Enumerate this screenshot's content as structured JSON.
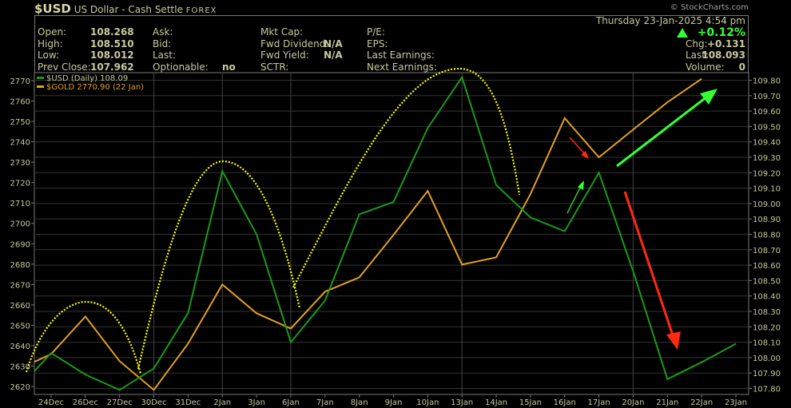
{
  "header": {
    "symbol": "$USD",
    "name": "US Dollar - Cash Settle",
    "exchange": "FOREX",
    "copyright": "© StockCharts.com",
    "datetime": "Thursday  23-Jan-2025  4:54 pm",
    "pct_change": "+0.12%",
    "direction_icon": "up-triangle-icon",
    "fields": {
      "open": {
        "label": "Open:",
        "value": "108.268"
      },
      "high": {
        "label": "High:",
        "value": "108.510"
      },
      "low": {
        "label": "Low:",
        "value": "108.012"
      },
      "prev_close": {
        "label": "Prev Close:",
        "value": "107.962"
      },
      "ask": {
        "label": "Ask:",
        "value": ""
      },
      "bid": {
        "label": "Bid:",
        "value": ""
      },
      "last_mid": {
        "label": "Last:",
        "value": ""
      },
      "optionable": {
        "label": "Optionable:",
        "value": "no"
      },
      "mkt_cap": {
        "label": "Mkt Cap:",
        "value": ""
      },
      "fwd_dividend": {
        "label": "Fwd Dividend:",
        "value": "N/A"
      },
      "fwd_yield": {
        "label": "Fwd Yield:",
        "value": "N/A"
      },
      "sctr": {
        "label": "SCTR:",
        "value": ""
      },
      "pe": {
        "label": "P/E:",
        "value": ""
      },
      "eps": {
        "label": "EPS:",
        "value": ""
      },
      "last_earnings": {
        "label": "Last Earnings:",
        "value": ""
      },
      "next_earnings": {
        "label": "Next Earnings:",
        "value": ""
      },
      "chg": {
        "label": "Chg:",
        "value": "+0.131"
      },
      "last": {
        "label": "Last:",
        "value": "108.093"
      },
      "volume": {
        "label": "Volume:",
        "value": "0"
      }
    }
  },
  "chart_data": {
    "type": "line",
    "categories": [
      "24Dec",
      "26Dec",
      "27Dec",
      "30Dec",
      "31Dec",
      "2Jan",
      "3Jan",
      "6Jan",
      "7Jan",
      "8Jan",
      "9Jan",
      "10Jan",
      "13Jan",
      "14Jan",
      "15Jan",
      "16Jan",
      "17Jan",
      "20Jan",
      "21Jan",
      "22Jan",
      "23Jan"
    ],
    "lead_in": {
      "usd": 107.79,
      "gold": 2628.0
    },
    "series": [
      {
        "name": "$USD (Daily) 108.09",
        "axis": "right",
        "color": "#1a9a1a",
        "values": [
          108.03,
          107.89,
          107.79,
          107.93,
          108.29,
          109.21,
          108.8,
          108.1,
          108.37,
          108.93,
          109.01,
          109.49,
          109.82,
          109.12,
          108.91,
          108.82,
          109.2,
          108.56,
          107.86,
          107.97,
          108.09
        ]
      },
      {
        "name": "$GOLD 2770.90 (22 Jan)",
        "axis": "left",
        "color": "#e0a020",
        "values": [
          2635.9,
          2654.3,
          2632.4,
          2618.3,
          2641.0,
          2670.0,
          2655.9,
          2648.4,
          2666.5,
          2673.5,
          2694.3,
          2715.9,
          2679.8,
          2683.3,
          2714.3,
          2751.6,
          2732.4,
          2746.0,
          2759.4,
          2770.9,
          null
        ]
      }
    ],
    "left_axis": {
      "ylim": [
        2620,
        2770
      ],
      "ticks": [
        2620,
        2630,
        2640,
        2650,
        2660,
        2670,
        2680,
        2690,
        2700,
        2710,
        2720,
        2730,
        2740,
        2750,
        2760,
        2770
      ]
    },
    "right_axis": {
      "ylim": [
        107.8,
        109.8
      ],
      "ticks": [
        "107.80",
        "107.90",
        "108.00",
        "108.10",
        "108.20",
        "108.30",
        "108.40",
        "108.50",
        "108.60",
        "108.70",
        "108.80",
        "108.90",
        "109.00",
        "109.10",
        "109.20",
        "109.30",
        "109.40",
        "109.50",
        "109.60",
        "109.70",
        "109.80"
      ]
    },
    "grid": true,
    "legend": "top-left",
    "annotation_colors": {
      "arc": "#ffff00",
      "up_arrow": "#33ff33",
      "down_arrow": "#ff2a10"
    }
  }
}
